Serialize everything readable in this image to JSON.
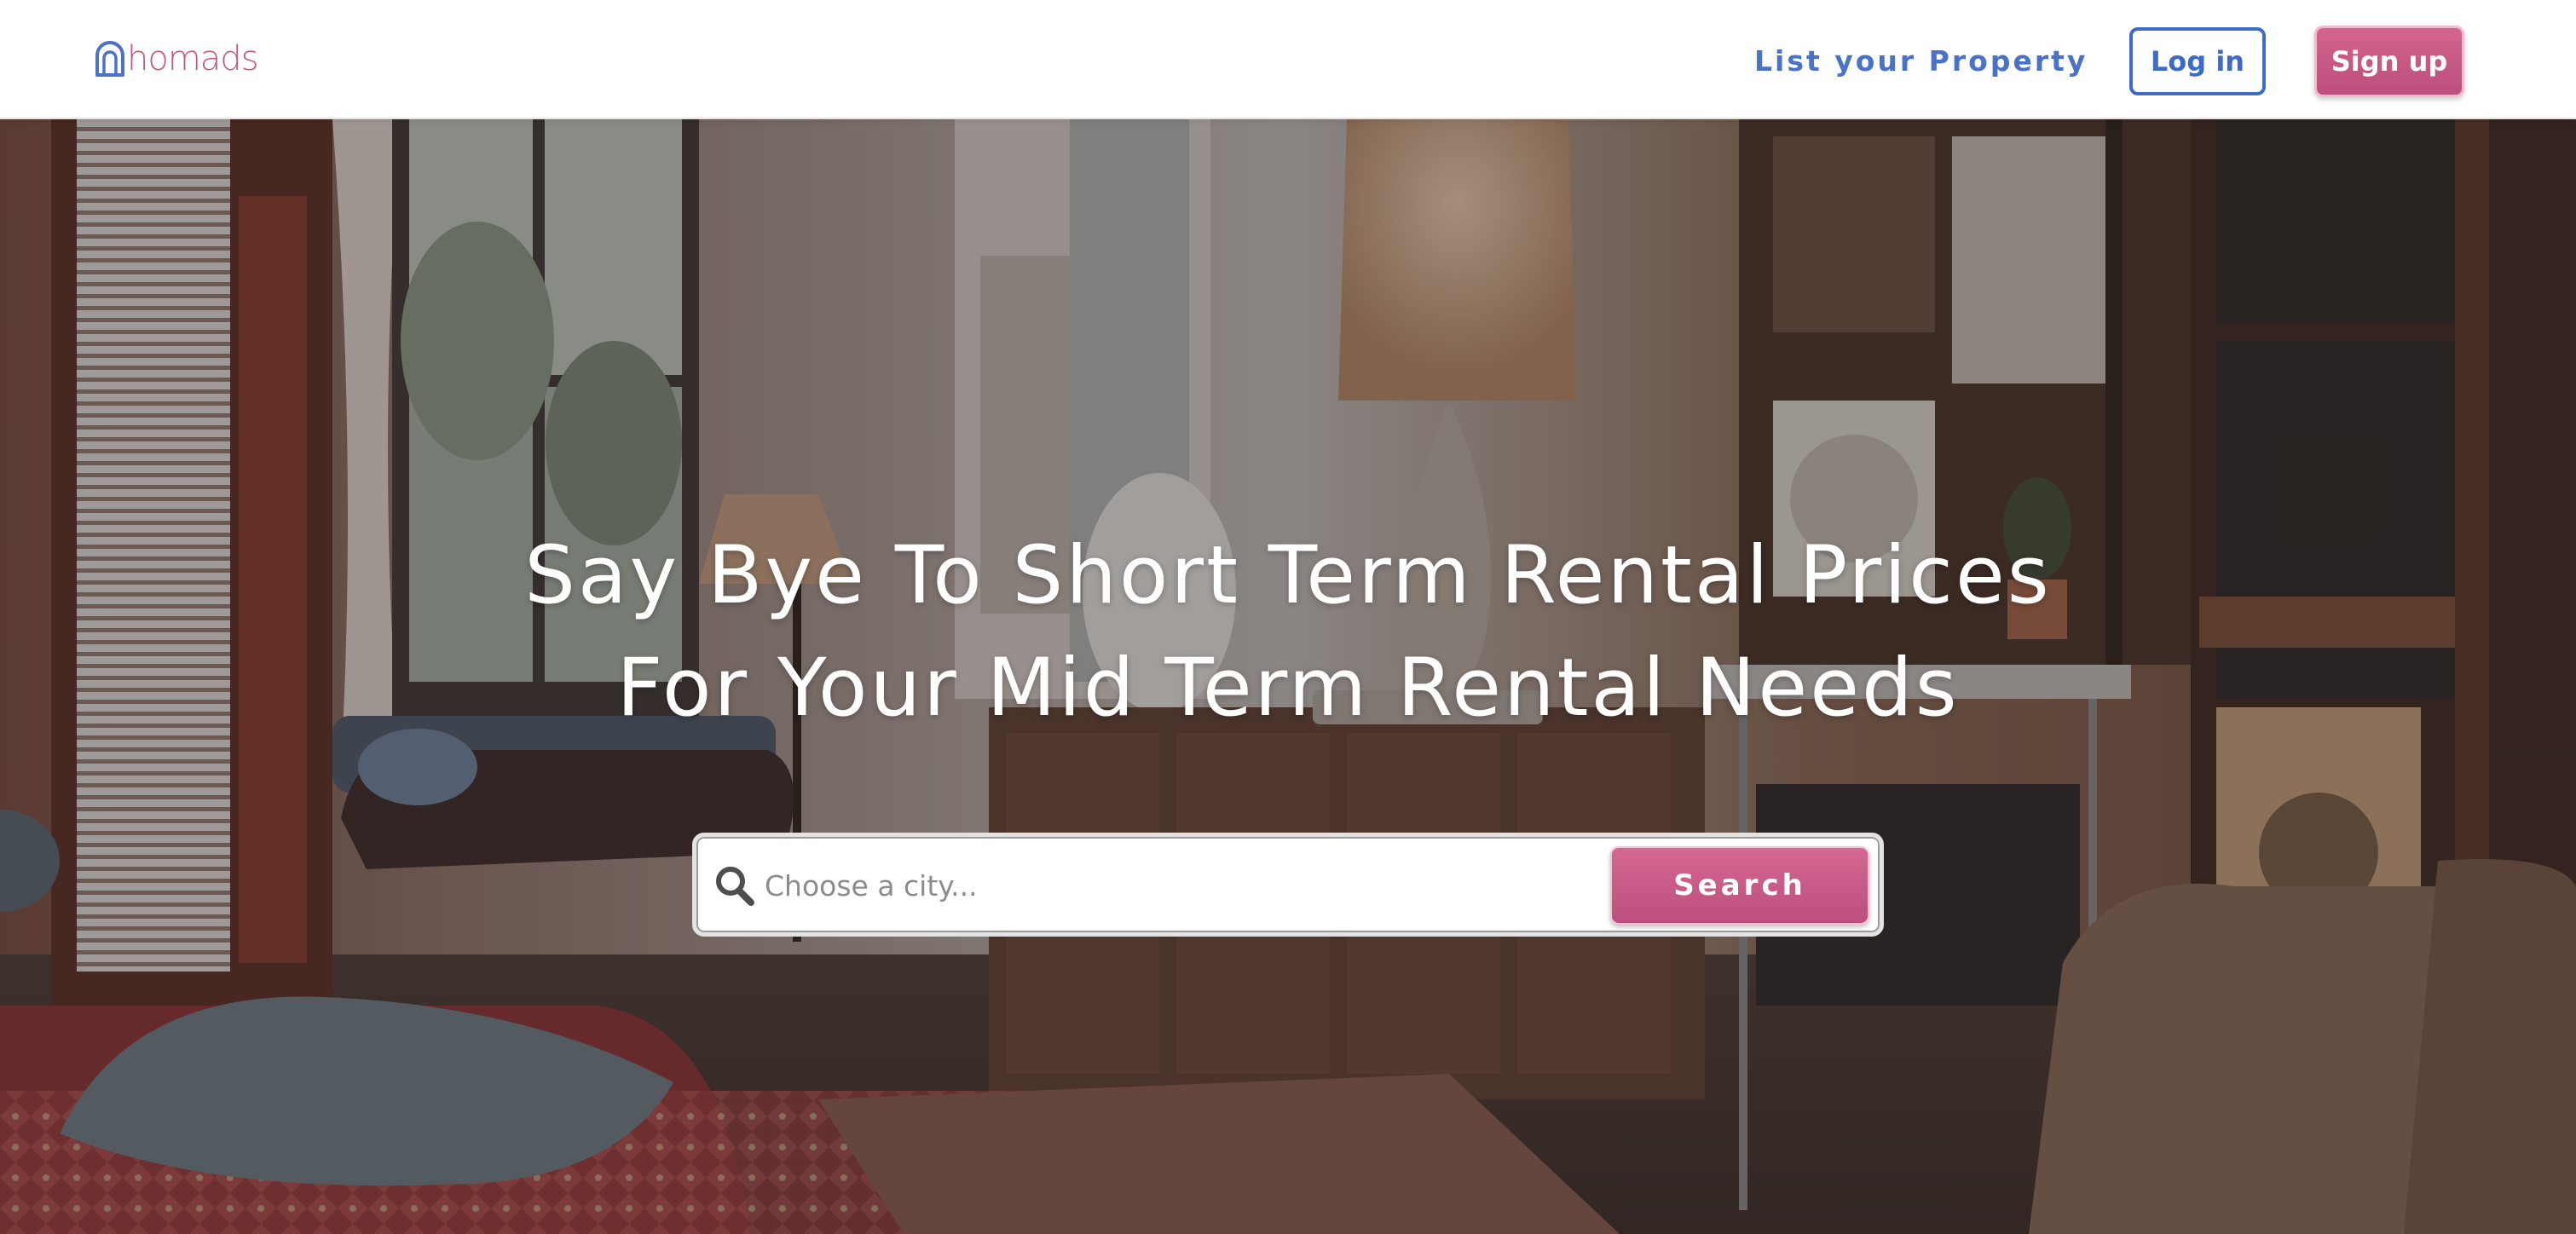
{
  "brand": {
    "name": "homads",
    "color": "#c4587f",
    "mark_icon": "arch-home-icon",
    "mark_color": "#4a72c9"
  },
  "nav": {
    "list_property": "List your Property",
    "login": "Log in",
    "signup": "Sign up"
  },
  "hero": {
    "headline_line1": "Say Bye To Short Term Rental Prices",
    "headline_line2": "For Your Mid Term Rental Needs",
    "background_icon": "living-room-photo"
  },
  "search": {
    "placeholder": "Choose a city...",
    "value": "",
    "button": "Search",
    "icon": "search-icon"
  },
  "colors": {
    "accent_pink": "#c4587f",
    "accent_blue": "#3f6bc8",
    "text_white": "#ffffff"
  }
}
